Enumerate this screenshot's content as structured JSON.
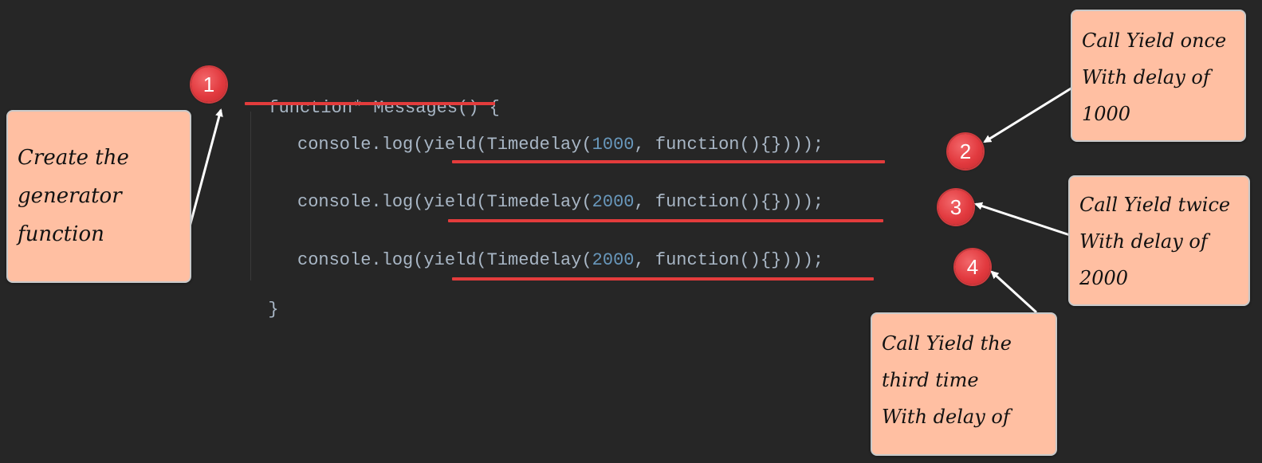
{
  "code": {
    "line1": "function* Messages() {",
    "line2": {
      "before": "console.log(yield(Timedelay(",
      "num": "1000",
      "after": ", function(){})));"
    },
    "line3": {
      "before": "console.log(yield(Timedelay(",
      "num": "2000",
      "after": ", function(){})));"
    },
    "line4": {
      "before": "console.log(yield(Timedelay(",
      "num": "2000",
      "after": ", function(){})));"
    },
    "line5": "}"
  },
  "badges": {
    "b1": "1",
    "b2": "2",
    "b3": "3",
    "b4": "4"
  },
  "notes": {
    "create": [
      "Create the",
      "generator",
      "function"
    ],
    "once": [
      "Call Yield once",
      "With delay of",
      "1000"
    ],
    "twice": [
      "Call Yield twice",
      "With delay of",
      "2000"
    ],
    "third": [
      "Call Yield the",
      "third time",
      "With delay of"
    ]
  },
  "colors": {
    "background": "#262626",
    "code_text": "#a9b7c6",
    "code_number": "#6897bb",
    "underline": "#e33c3c",
    "badge": "#e23a3f",
    "note_fill": "#ffbfa2"
  }
}
